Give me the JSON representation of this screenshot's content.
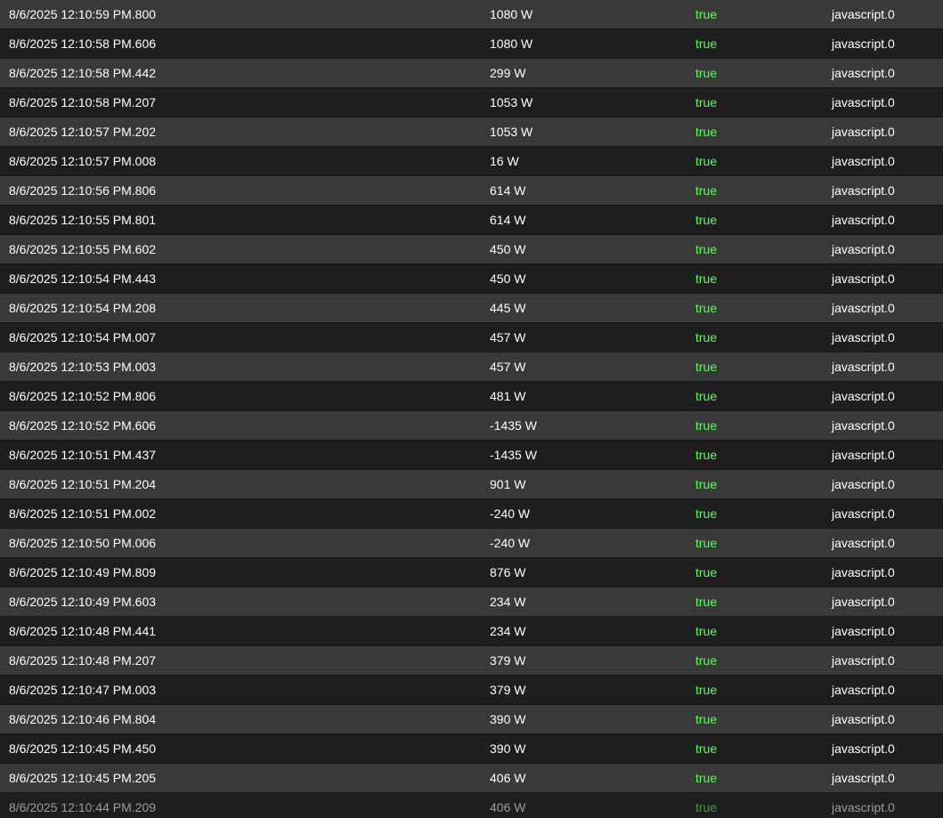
{
  "history": {
    "ack_color": "#5cff5c",
    "rows": [
      {
        "ts": "8/6/2025 12:10:59 PM.800",
        "val": "1080 W",
        "ack": "true",
        "from": "javascript.0"
      },
      {
        "ts": "8/6/2025 12:10:58 PM.606",
        "val": "1080 W",
        "ack": "true",
        "from": "javascript.0"
      },
      {
        "ts": "8/6/2025 12:10:58 PM.442",
        "val": "299 W",
        "ack": "true",
        "from": "javascript.0"
      },
      {
        "ts": "8/6/2025 12:10:58 PM.207",
        "val": "1053 W",
        "ack": "true",
        "from": "javascript.0"
      },
      {
        "ts": "8/6/2025 12:10:57 PM.202",
        "val": "1053 W",
        "ack": "true",
        "from": "javascript.0"
      },
      {
        "ts": "8/6/2025 12:10:57 PM.008",
        "val": "16 W",
        "ack": "true",
        "from": "javascript.0"
      },
      {
        "ts": "8/6/2025 12:10:56 PM.806",
        "val": "614 W",
        "ack": "true",
        "from": "javascript.0"
      },
      {
        "ts": "8/6/2025 12:10:55 PM.801",
        "val": "614 W",
        "ack": "true",
        "from": "javascript.0"
      },
      {
        "ts": "8/6/2025 12:10:55 PM.602",
        "val": "450 W",
        "ack": "true",
        "from": "javascript.0"
      },
      {
        "ts": "8/6/2025 12:10:54 PM.443",
        "val": "450 W",
        "ack": "true",
        "from": "javascript.0"
      },
      {
        "ts": "8/6/2025 12:10:54 PM.208",
        "val": "445 W",
        "ack": "true",
        "from": "javascript.0"
      },
      {
        "ts": "8/6/2025 12:10:54 PM.007",
        "val": "457 W",
        "ack": "true",
        "from": "javascript.0"
      },
      {
        "ts": "8/6/2025 12:10:53 PM.003",
        "val": "457 W",
        "ack": "true",
        "from": "javascript.0"
      },
      {
        "ts": "8/6/2025 12:10:52 PM.806",
        "val": "481 W",
        "ack": "true",
        "from": "javascript.0"
      },
      {
        "ts": "8/6/2025 12:10:52 PM.606",
        "val": "-1435 W",
        "ack": "true",
        "from": "javascript.0"
      },
      {
        "ts": "8/6/2025 12:10:51 PM.437",
        "val": "-1435 W",
        "ack": "true",
        "from": "javascript.0"
      },
      {
        "ts": "8/6/2025 12:10:51 PM.204",
        "val": "901 W",
        "ack": "true",
        "from": "javascript.0"
      },
      {
        "ts": "8/6/2025 12:10:51 PM.002",
        "val": "-240 W",
        "ack": "true",
        "from": "javascript.0"
      },
      {
        "ts": "8/6/2025 12:10:50 PM.006",
        "val": "-240 W",
        "ack": "true",
        "from": "javascript.0"
      },
      {
        "ts": "8/6/2025 12:10:49 PM.809",
        "val": "876 W",
        "ack": "true",
        "from": "javascript.0"
      },
      {
        "ts": "8/6/2025 12:10:49 PM.603",
        "val": "234 W",
        "ack": "true",
        "from": "javascript.0"
      },
      {
        "ts": "8/6/2025 12:10:48 PM.441",
        "val": "234 W",
        "ack": "true",
        "from": "javascript.0"
      },
      {
        "ts": "8/6/2025 12:10:48 PM.207",
        "val": "379 W",
        "ack": "true",
        "from": "javascript.0"
      },
      {
        "ts": "8/6/2025 12:10:47 PM.003",
        "val": "379 W",
        "ack": "true",
        "from": "javascript.0"
      },
      {
        "ts": "8/6/2025 12:10:46 PM.804",
        "val": "390 W",
        "ack": "true",
        "from": "javascript.0"
      },
      {
        "ts": "8/6/2025 12:10:45 PM.450",
        "val": "390 W",
        "ack": "true",
        "from": "javascript.0"
      },
      {
        "ts": "8/6/2025 12:10:45 PM.205",
        "val": "406 W",
        "ack": "true",
        "from": "javascript.0"
      },
      {
        "ts": "8/6/2025 12:10:44 PM.209",
        "val": "406 W",
        "ack": "true",
        "from": "javascript.0"
      }
    ]
  }
}
